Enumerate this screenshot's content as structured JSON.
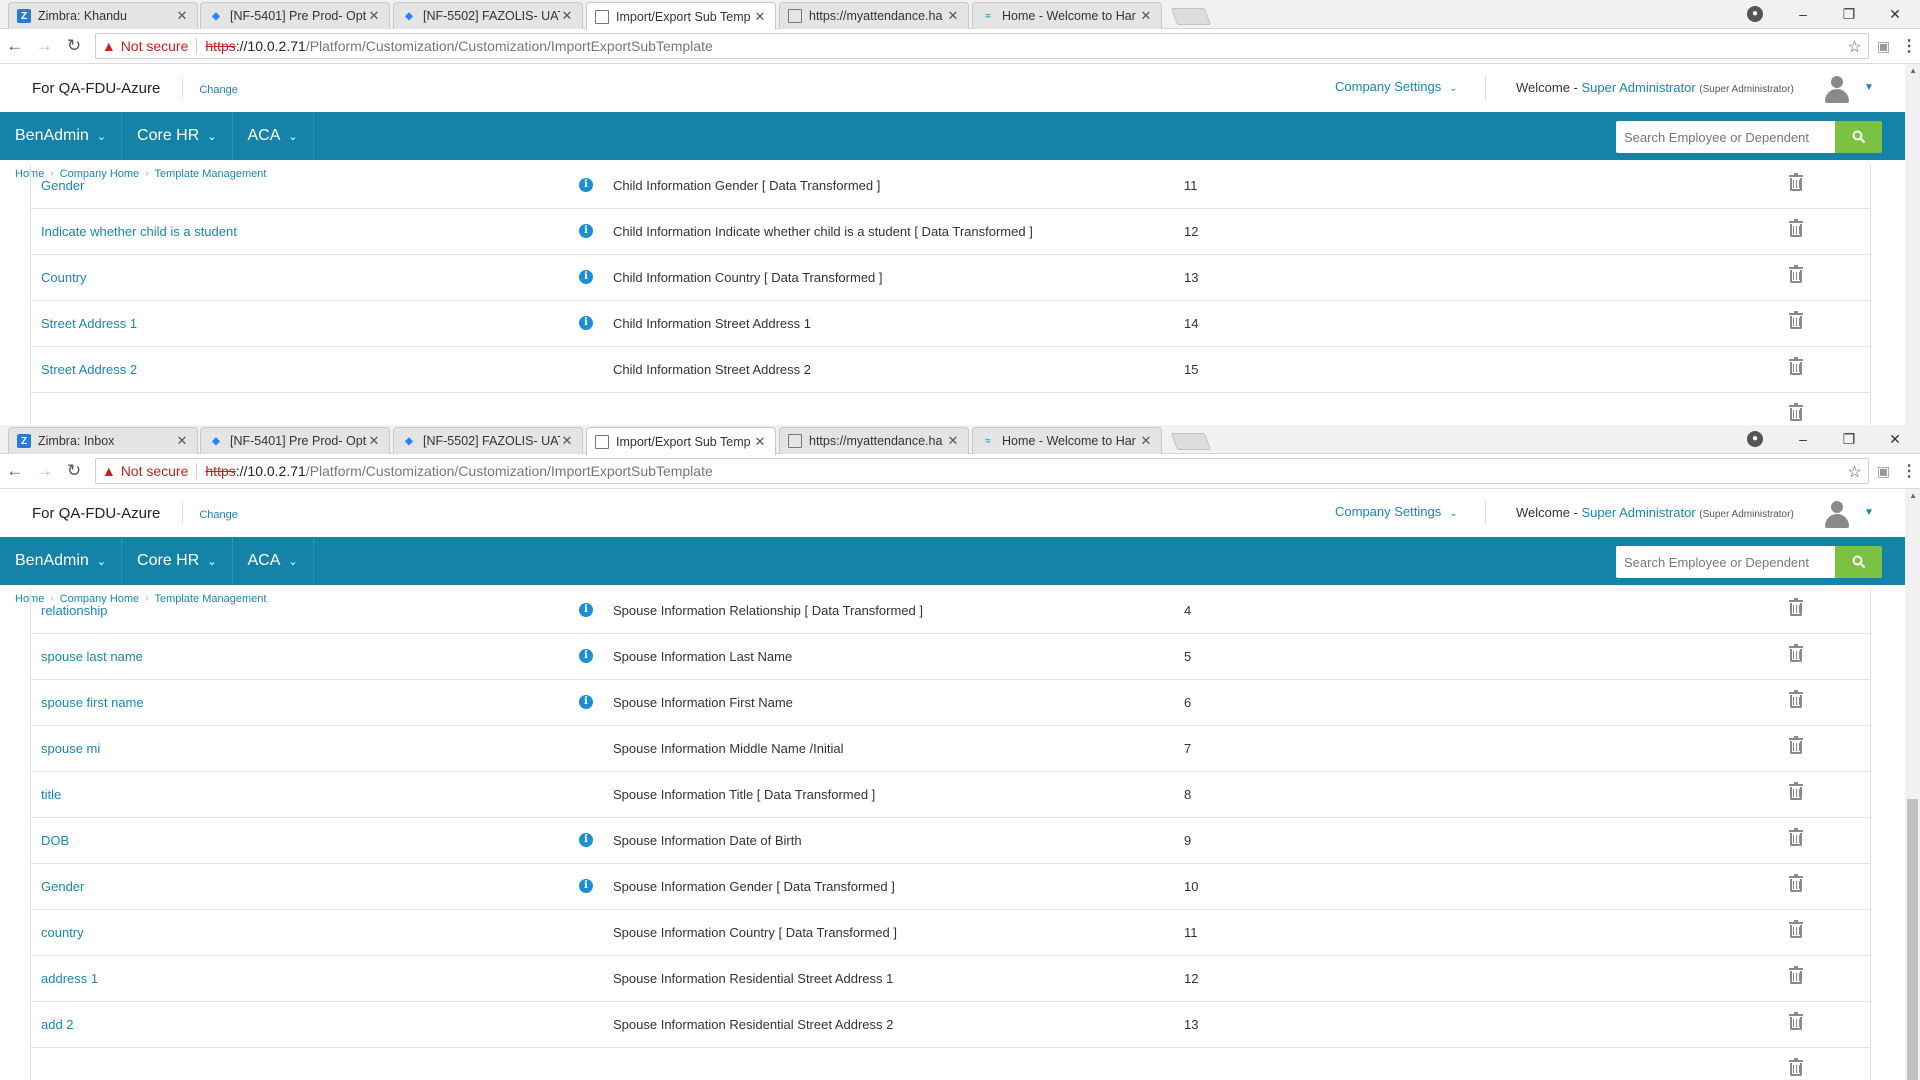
{
  "windows": [
    {
      "tabs": [
        {
          "icon": "zimbra-icon",
          "title": "Zimbra: Khandu"
        },
        {
          "icon": "jira-icon",
          "title": "[NF-5401] Pre Prod- Opt"
        },
        {
          "icon": "jira-icon",
          "title": "[NF-5502] FAZOLIS- UAT"
        },
        {
          "icon": "page-icon",
          "title": "Import/Export Sub Temp"
        },
        {
          "icon": "page-icon",
          "title": "https://myattendance.ha"
        },
        {
          "icon": "site-icon",
          "title": "Home - Welcome to Har"
        }
      ],
      "rows": [
        {
          "field": "Gender",
          "info": true,
          "desc": "Child Information Gender [ Data Transformed ]",
          "num": "11"
        },
        {
          "field": "Indicate whether child is a student",
          "info": true,
          "desc": "Child Information Indicate whether child is a student [ Data Transformed ]",
          "num": "12"
        },
        {
          "field": "Country",
          "info": true,
          "desc": "Child Information Country [ Data Transformed ]",
          "num": "13"
        },
        {
          "field": "Street Address 1",
          "info": true,
          "desc": "Child Information Street Address 1",
          "num": "14"
        },
        {
          "field": "Street Address 2",
          "info": false,
          "desc": "Child Information Street Address 2",
          "num": "15"
        }
      ]
    },
    {
      "tabs": [
        {
          "icon": "zimbra-icon",
          "title": "Zimbra: Inbox"
        },
        {
          "icon": "jira-icon",
          "title": "[NF-5401] Pre Prod- Opt"
        },
        {
          "icon": "jira-icon",
          "title": "[NF-5502] FAZOLIS- UAT"
        },
        {
          "icon": "page-icon",
          "title": "Import/Export Sub Temp"
        },
        {
          "icon": "page-icon",
          "title": "https://myattendance.ha"
        },
        {
          "icon": "site-icon",
          "title": "Home - Welcome to Har"
        }
      ],
      "rows": [
        {
          "field": "relationship",
          "info": true,
          "desc": "Spouse Information Relationship [ Data Transformed ]",
          "num": "4"
        },
        {
          "field": "spouse last name",
          "info": true,
          "desc": "Spouse Information Last Name",
          "num": "5"
        },
        {
          "field": "spouse first name",
          "info": true,
          "desc": "Spouse Information First Name",
          "num": "6"
        },
        {
          "field": "spouse mi",
          "info": false,
          "desc": "Spouse Information Middle Name /Initial",
          "num": "7"
        },
        {
          "field": "title",
          "info": false,
          "desc": "Spouse Information Title [ Data Transformed ]",
          "num": "8"
        },
        {
          "field": "DOB",
          "info": true,
          "desc": "Spouse Information Date of Birth",
          "num": "9"
        },
        {
          "field": "Gender",
          "info": true,
          "desc": "Spouse Information Gender [ Data Transformed ]",
          "num": "10"
        },
        {
          "field": "country",
          "info": false,
          "desc": "Spouse Information Country [ Data Transformed ]",
          "num": "11"
        },
        {
          "field": "address 1",
          "info": false,
          "desc": "Spouse Information Residential Street Address 1",
          "num": "12"
        },
        {
          "field": "add 2",
          "info": false,
          "desc": "Spouse Information Residential Street Address 2",
          "num": "13"
        }
      ]
    }
  ],
  "browser": {
    "not_secure": "Not secure",
    "url_scheme": "https",
    "url_host": "://10.0.2.71",
    "url_path": "/Platform/Customization/Customization/ImportExportSubTemplate"
  },
  "header": {
    "company": "For QA-FDU-Azure",
    "change": "Change",
    "company_settings": "Company Settings",
    "welcome": "Welcome - ",
    "admin": "Super Administrator",
    "role": "(Super Administrator)"
  },
  "nav": {
    "items": [
      "BenAdmin",
      "Core HR",
      "ACA"
    ],
    "search_placeholder": "Search Employee or Dependent"
  },
  "breadcrumb": [
    "Home",
    "Company Home",
    "Template Management"
  ],
  "colors": {
    "nav_bg": "#1582a8",
    "link": "#1a86b8",
    "search_button": "#7cc242",
    "info_icon": "#1a8fd6"
  }
}
